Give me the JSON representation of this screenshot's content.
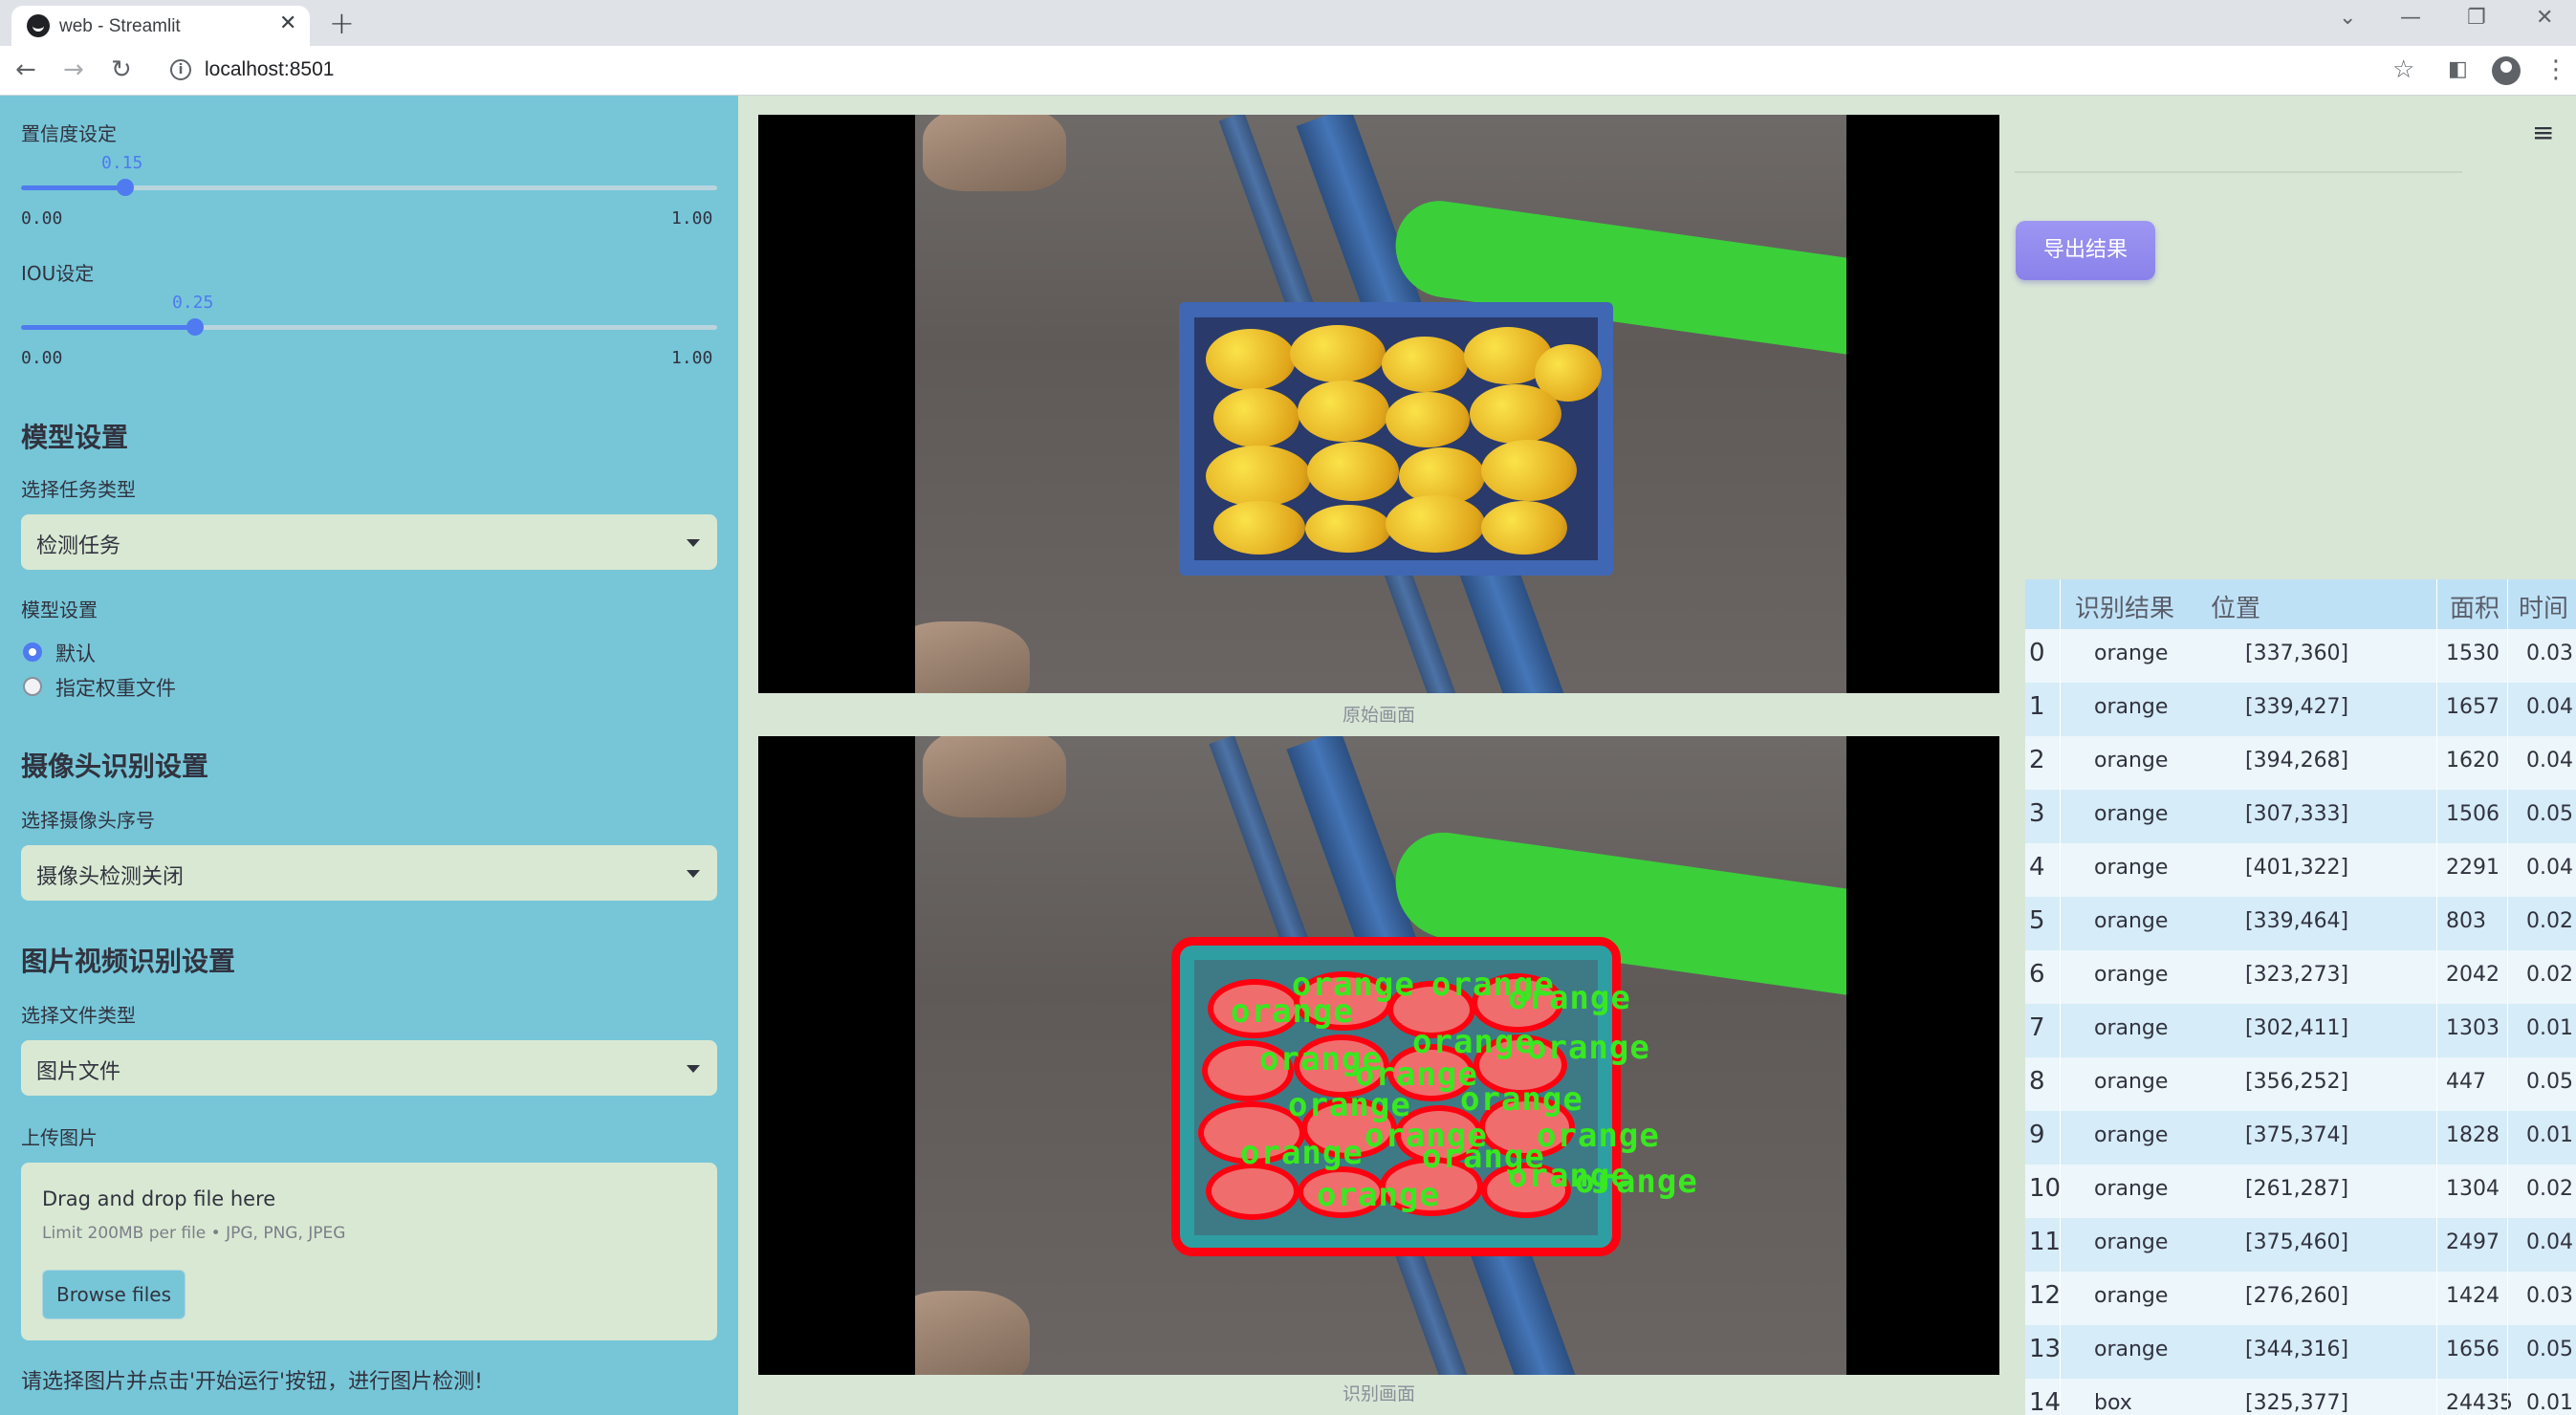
{
  "browser": {
    "tab_title": "web - Streamlit",
    "url": "localhost:8501"
  },
  "sidebar": {
    "confidence": {
      "label": "置信度设定",
      "value": "0.15",
      "min": "0.00",
      "max": "1.00",
      "fraction": 0.15
    },
    "iou": {
      "label": "IOU设定",
      "value": "0.25",
      "min": "0.00",
      "max": "1.00",
      "fraction": 0.25
    },
    "model_section": {
      "header": "模型设置",
      "task_label": "选择任务类型",
      "task_value": "检测任务",
      "model_label": "模型设置",
      "radio_options": [
        "默认",
        "指定权重文件"
      ],
      "radio_selected": 0
    },
    "camera_section": {
      "header": "摄像头识别设置",
      "camera_label": "选择摄像头序号",
      "camera_value": "摄像头检测关闭"
    },
    "media_section": {
      "header": "图片视频识别设置",
      "file_type_label": "选择文件类型",
      "file_type_value": "图片文件",
      "upload_label": "上传图片",
      "drop_title": "Drag and drop file here",
      "drop_limit": "Limit 200MB per file • JPG, PNG, JPEG",
      "browse_label": "Browse files"
    },
    "hint": "请选择图片并点击'开始运行'按钮，进行图片检测!"
  },
  "main": {
    "original_caption": "原始画面",
    "detected_caption": "识别画面",
    "export_label": "导出结果",
    "detection_label_text": "orange",
    "table": {
      "columns": [
        "",
        "识别结果",
        "位置",
        "面积",
        "时间"
      ],
      "rows": [
        [
          "0",
          "orange",
          "[337,360]",
          "1530",
          "0.03"
        ],
        [
          "1",
          "orange",
          "[339,427]",
          "1657",
          "0.04"
        ],
        [
          "2",
          "orange",
          "[394,268]",
          "1620",
          "0.04"
        ],
        [
          "3",
          "orange",
          "[307,333]",
          "1506",
          "0.05"
        ],
        [
          "4",
          "orange",
          "[401,322]",
          "2291",
          "0.04"
        ],
        [
          "5",
          "orange",
          "[339,464]",
          "803",
          "0.02"
        ],
        [
          "6",
          "orange",
          "[323,273]",
          "2042",
          "0.02"
        ],
        [
          "7",
          "orange",
          "[302,411]",
          "1303",
          "0.01"
        ],
        [
          "8",
          "orange",
          "[356,252]",
          "447",
          "0.05"
        ],
        [
          "9",
          "orange",
          "[375,374]",
          "1828",
          "0.01"
        ],
        [
          "10",
          "orange",
          "[261,287]",
          "1304",
          "0.02"
        ],
        [
          "11",
          "orange",
          "[375,460]",
          "2497",
          "0.04"
        ],
        [
          "12",
          "orange",
          "[276,260]",
          "1424",
          "0.03"
        ],
        [
          "13",
          "orange",
          "[344,316]",
          "1656",
          "0.05"
        ],
        [
          "14",
          "box",
          "[325,377]",
          "24435",
          "0.01"
        ]
      ]
    }
  }
}
